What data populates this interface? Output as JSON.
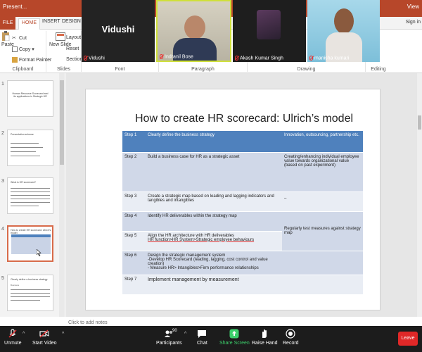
{
  "powerpoint": {
    "titlebar_left": "Present...",
    "titlebar_right": "View",
    "tabs": {
      "file": "FILE",
      "home": "HOME",
      "insert": "INSERT",
      "design": "DESIGN"
    },
    "sign_in": "Sign in",
    "ribbon": {
      "paste": "Paste",
      "cut": "Cut",
      "copy": "Copy",
      "format_painter": "Format Painter",
      "new_slide": "New Slide",
      "layout": "Layout",
      "reset": "Reset",
      "section": "Section",
      "groups": {
        "clipboard": "Clipboard",
        "slides": "Slides",
        "font": "Font",
        "paragraph": "Paragraph",
        "drawing": "Drawing",
        "editing": "Editing"
      }
    },
    "thumbnails": [
      {
        "num": "1",
        "lines": [
          "Human Resource Scorecard and",
          "its applications in Strategic HR"
        ]
      },
      {
        "num": "2",
        "lines": [
          "Presentation scheme"
        ]
      },
      {
        "num": "3",
        "lines": [
          "What is HR scorecard?"
        ]
      },
      {
        "num": "4",
        "lines": [
          "How to create HR scorecard: Ulrich's model"
        ]
      },
      {
        "num": "5",
        "lines": [
          "Clearly define a business strategy",
          "Business"
        ]
      },
      {
        "num": "6",
        "lines": []
      }
    ],
    "notes_placeholder": "Click to add notes"
  },
  "slide": {
    "title": "How to create HR scorecard: Ulrich’s model",
    "rows": [
      {
        "step": "Step 1",
        "action": "Clearly define the business strategy",
        "value": "Innovation, outsourcing, partnership etc."
      },
      {
        "step": "Step 2",
        "action": "Build a business case for HR as a strategic asset",
        "value": "Creating/enhancing  individual employee value towards organizational value (based on past experiment)"
      },
      {
        "step": "Step 3",
        "action": "Create a strategic map based on leading and lagging indicators and tangibles and intangibles",
        "value": "–"
      },
      {
        "step": "Step 4",
        "action": "Identify HR deliverables within the strategy map",
        "value": "Regularly test measures against strategy map"
      },
      {
        "step": "Step 5",
        "action": "Align the HR architecture with HR deliverables",
        "action2": "HR function>HR System>Strategic employee behaviours",
        "value": ""
      },
      {
        "step": "Step 6",
        "action": "Design the strategic management system",
        "action2": "-Develop HR Scorecard (leading, lagging, cost control and value creation)",
        "action3": "- Measure HR> Intangibles>Firm performance relationships",
        "value": ""
      },
      {
        "step": "Step 7",
        "action": "Implement management by measurement",
        "value": ""
      }
    ]
  },
  "zoom": {
    "participants": [
      {
        "name": "Vidushi",
        "big_label": "Vidushi",
        "muted": true
      },
      {
        "name": "Indranil Bose",
        "muted": true
      },
      {
        "name": "Akash Kumar Singh",
        "muted": true
      },
      {
        "name": "manisha kumari",
        "muted": true
      }
    ],
    "controls": {
      "unmute": "Unmute",
      "start_video": "Start Video",
      "participants": "Participants",
      "participants_count": "90",
      "chat": "Chat",
      "share_screen": "Share Screen",
      "raise_hand": "Raise Hand",
      "record": "Record",
      "leave": "Leave"
    },
    "colors": {
      "share_green": "#3ccf6b",
      "leave_red": "#e02828",
      "ppt_red": "#b7472a",
      "table_header": "#4f81bd"
    }
  }
}
